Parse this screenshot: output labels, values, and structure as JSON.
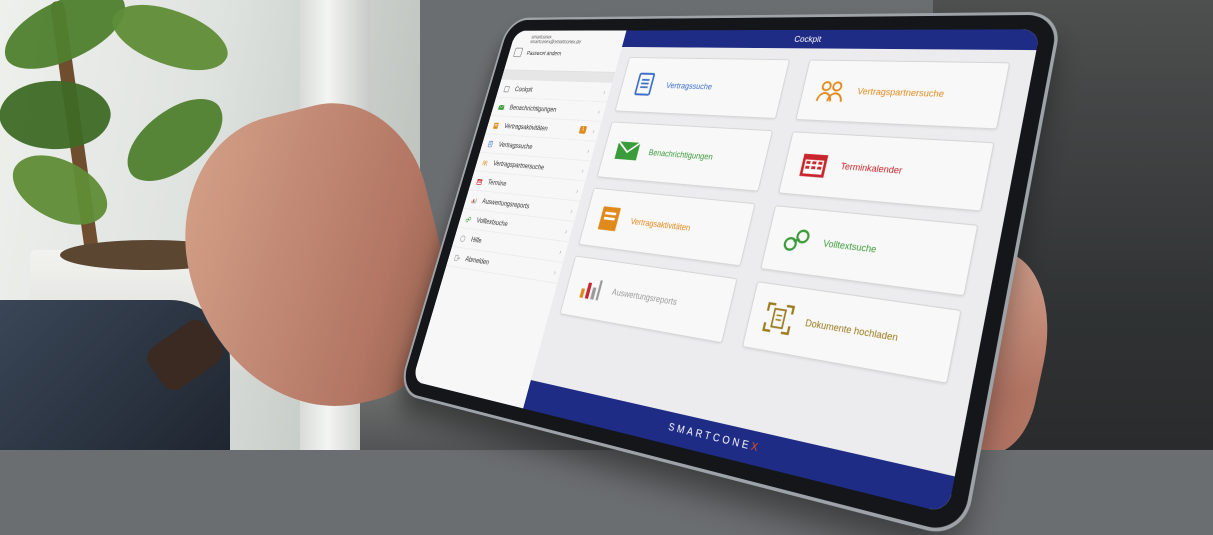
{
  "app": {
    "brand": "SMARTCONE",
    "brand_x": "X",
    "header_title": "Cockpit"
  },
  "sidebar": {
    "user_name": "smartconex",
    "user_email": "smartconex@smartconex.de",
    "password_label": "Passwort ändern",
    "items": [
      {
        "label": "Cockpit",
        "icon": "home-icon",
        "color": "#8a8a8a"
      },
      {
        "label": "Benachrichtigungen",
        "icon": "envelope-icon",
        "color": "#3a9b3a"
      },
      {
        "label": "Vertragsaktivitäten",
        "icon": "folder-icon",
        "color": "#e08a1c",
        "badge": "1"
      },
      {
        "label": "Vertragssuche",
        "icon": "document-icon",
        "color": "#3b6fc6"
      },
      {
        "label": "Vertragspartnersuche",
        "icon": "people-icon",
        "color": "#e08a1c"
      },
      {
        "label": "Termine",
        "icon": "calendar-icon",
        "color": "#c8252c"
      },
      {
        "label": "Auswertungsreports",
        "icon": "chart-icon",
        "color": "#9a9a9a"
      },
      {
        "label": "Volltextsuche",
        "icon": "link-icon",
        "color": "#3a9b3a"
      },
      {
        "label": "Hilfe",
        "icon": "help-icon",
        "color": "#9a9a9a"
      },
      {
        "label": "Abmelden",
        "icon": "logout-icon",
        "color": "#9a9a9a"
      }
    ]
  },
  "tiles": [
    {
      "label": "Vertragssuche",
      "icon": "document-icon",
      "color": "#3b6fc6"
    },
    {
      "label": "Vertragspartnersuche",
      "icon": "people-icon",
      "color": "#e08a1c"
    },
    {
      "label": "Benachrichtigungen",
      "icon": "envelope-icon",
      "color": "#3a9b3a"
    },
    {
      "label": "Terminkalender",
      "icon": "calendar-icon",
      "color": "#c8252c"
    },
    {
      "label": "Vertragsaktivitäten",
      "icon": "folder-icon",
      "color": "#e08a1c"
    },
    {
      "label": "Volltextsuche",
      "icon": "link-icon",
      "color": "#3a9b3a"
    },
    {
      "label": "Auswertungsreports",
      "icon": "chart-icon",
      "color": "#9a9a9a"
    },
    {
      "label": "Dokumente hochladen",
      "icon": "scan-document-icon",
      "color": "#9a7a1a"
    }
  ]
}
